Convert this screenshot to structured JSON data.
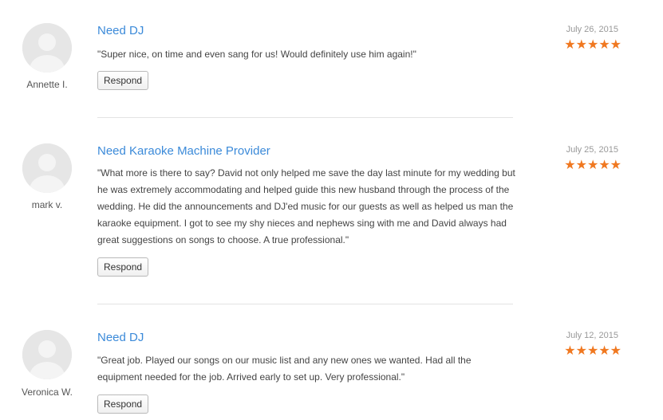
{
  "reviews": [
    {
      "author": "Annette I.",
      "title": "Need DJ",
      "text": "\"Super nice, on time and even sang for us! Would definitely use him again!\"",
      "date": "July 26, 2015",
      "rating": 5,
      "stars": "★★★★★",
      "respond_label": "Respond"
    },
    {
      "author": "mark v.",
      "title": "Need Karaoke Machine Provider",
      "text": "\"What more is there to say? David not only helped me save the day last minute for my wedding but he was extremely accommodating and helped guide this new husband through the process of the wedding. He did the announcements and DJ'ed music for our guests as well as helped us man the karaoke equipment. I got to see my shy nieces and nephews sing with me and David always had great suggestions on songs to choose. A true professional.\"",
      "date": "July 25, 2015",
      "rating": 5,
      "stars": "★★★★★",
      "respond_label": "Respond"
    },
    {
      "author": "Veronica W.",
      "title": "Need DJ",
      "text": "\"Great job. Played our songs on our music list and any new ones we wanted. Had all the equipment needed for the job. Arrived early to set up. Very professional.\"",
      "date": "July 12, 2015",
      "rating": 5,
      "stars": "★★★★★",
      "respond_label": "Respond"
    }
  ],
  "colors": {
    "title": "#3b8ad9",
    "star": "#f07820",
    "date": "#999999",
    "text": "#444444"
  },
  "icons": {
    "avatar": "user-silhouette-icon",
    "star": "star-icon"
  }
}
